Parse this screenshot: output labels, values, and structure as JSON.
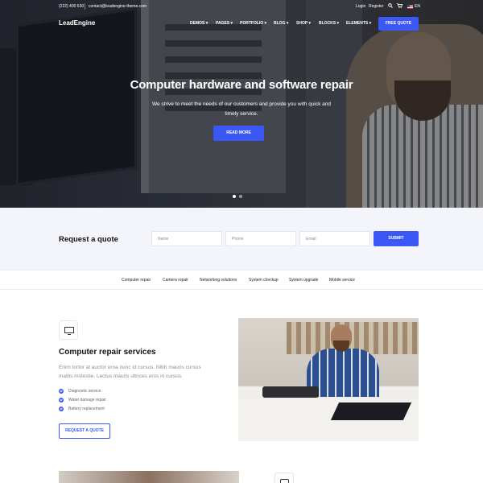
{
  "topbar": {
    "phone": "(222) 400 630",
    "email": "contact@leadengine-theme.com",
    "login": "Login",
    "register": "Register",
    "search_icon": "search-icon",
    "cart_icon": "cart-icon",
    "language": "EN"
  },
  "header": {
    "logo": "LeadEngine",
    "nav": [
      "DEMOS",
      "PAGES",
      "PORTFOLIO",
      "BLOG",
      "SHOP",
      "BLOCKS",
      "ELEMENTS"
    ],
    "cta": "FREE QUOTE"
  },
  "hero": {
    "title": "Computer hardware and software repair",
    "subtitle": "We strive to meet the needs of our customers and provide you with quick and timely service.",
    "button": "READ MORE",
    "slides": 2,
    "active_slide": 1
  },
  "quote": {
    "title": "Request a quote",
    "name_placeholder": "Name",
    "phone_placeholder": "Phone",
    "email_placeholder": "Email",
    "submit": "SUBMIT"
  },
  "services": [
    "Computer repair",
    "Camera repair",
    "Networking solutions",
    "System checkup",
    "System upgrade",
    "Mobile service"
  ],
  "feature": {
    "icon": "monitor-icon",
    "title": "Computer repair services",
    "text": "Enim tortor at auctor urna nunc id cursus. Nibh mauris cursus mattis molestie. Lectus mauris ultrices eros in cursus.",
    "checklist": [
      "Diagnostic service",
      "Water damage repair",
      "Battery replacement"
    ],
    "button": "REQUEST A QUOTE"
  },
  "colors": {
    "accent": "#3b57f5",
    "quote_bg": "#f4f5fa"
  }
}
